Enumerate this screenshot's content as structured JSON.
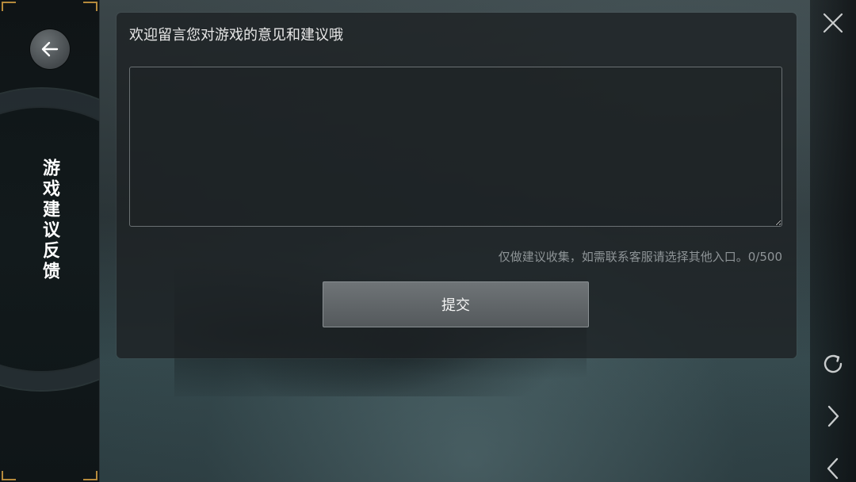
{
  "sidebar": {
    "title": "游戏建议反馈",
    "back_icon": "arrow-left-icon"
  },
  "panel": {
    "title": "欢迎留言您对游戏的意见和建议哦",
    "input_value": "",
    "hint": "仅做建议收集，如需联系客服请选择其他入口。0/500",
    "submit_label": "提交"
  },
  "right_controls": {
    "close_icon": "close-icon",
    "refresh_icon": "refresh-icon",
    "forward_icon": "chevron-right-icon",
    "back_icon": "chevron-left-icon"
  },
  "colors": {
    "accent_gold": "#b58a3c",
    "panel_bg": "#1c2022",
    "button_bg": "#5f6467"
  }
}
